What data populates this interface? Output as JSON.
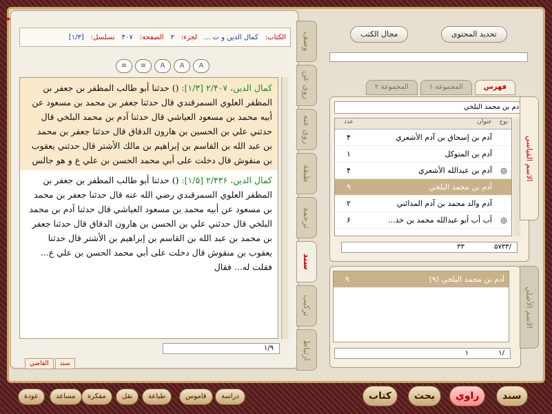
{
  "info_bar": {
    "book_label": "الكتاب:",
    "book_value": "كمال الدين و ت ...",
    "part_label": "لجزء:",
    "part_value": "۳",
    "page_label": "الصفحة:",
    "page_value": "۴۰۷",
    "seq_label": "تسلسل:",
    "seq_value": "[۱/۳]"
  },
  "toolbar_icons": [
    "format-icon-1",
    "format-icon-2",
    "format-icon-3",
    "format-icon-4",
    "format-icon-5"
  ],
  "text_para1": {
    "src": "كمال الدين، ۲/۴۰۷ [۱/۳]:",
    "body": "() حدثنا أبو طالب المظفر بن جعفر بن المظفر العلوي السمرقندي قال حدثنا جعفر بن محمد بن مسعود عن أبيه محمد بن مسعود العياشي قال حدثنا آدم بن محمد البلخي قال حدثني علي بن الحسين بن هارون الدقاق قال حدثنا جعفر بن محمد بن عبد الله بن القاسم بن إبراهيم بن مالك الأشتر قال حدثني يعقوب بن منقوش قال دخلت على أبي محمد الحسن بن علي ع و هو جالس"
  },
  "text_para2": {
    "src": "كمال الدين، ۲/۴۳۶ [۱/۵]:",
    "body": "() حدثنا أبو طالب المظفر بن جعفر بن المظفر العلوي السمرقندي رضي الله عنه قال حدثنا جعفر بن محمد بن مسعود عن أبيه محمد بن مسعود العياشي قال حدثنا آدم بن محمد البلخي قال حدثني علي بن الحسن بن هارون الدقاق قال حدثنا جعفر بن محمد بن عبد الله بن القاسم بن إبراهيم بن الأشتر قال حدثنا يعقوب بن منقوش قال دخلت على أبي محمد الحسن بن علي ع... فقلت له... فقال"
  },
  "left_page_box": "۱/۹",
  "left_tabs": [
    "القاضي",
    "سند"
  ],
  "vertical_tabs": [
    "وصف",
    "روى عن",
    "روى عنه",
    "طبقة",
    "ترجمة",
    "سند",
    "تركيب",
    "ارتباط"
  ],
  "top_buttons": {
    "refresh": "تحديد المحتوى",
    "library": "مجال الكتب"
  },
  "index_tabs": [
    "فهرس",
    "المجموعة ۱",
    "المجموعة ۲"
  ],
  "list_search_value": "آدم بن محمد البلخي",
  "grid_headers": {
    "type": "نوع",
    "title": "عنوان",
    "count": "عدد"
  },
  "grid_rows": [
    {
      "type": "",
      "title": "آدم بن إسحاق بن آدم الأشعري",
      "count": "۴"
    },
    {
      "type": "",
      "title": "آدم بن المتوكل",
      "count": "۱"
    },
    {
      "type": "◎",
      "title": "آدم بن عبدالله الأشعري",
      "count": "۴"
    },
    {
      "type": "",
      "title": "آدم بن محمد البلخي",
      "count": "۹"
    },
    {
      "type": "",
      "title": "آدم والد محمد بن آدم المدائني",
      "count": "۲"
    },
    {
      "type": "◎",
      "title": "أب أب أبو عبدالله محمد بن خذ...",
      "count": "۶"
    }
  ],
  "count_box": {
    "current": "۳۳",
    "total": "/۵۷۳۳"
  },
  "side_tab_upper": "الاسم القياسي",
  "side_tab_lower": "الاسم الأصلي",
  "lower_list_item": {
    "title": "آدم بن محمد البلخي (۹)",
    "count": "۹"
  },
  "lower_count": {
    "current": "۱",
    "total": "/۱"
  },
  "bottom_buttons": {
    "left": [
      "عودة",
      "مساعد",
      "مفكرة",
      "نقل",
      "طباعة",
      "قاموس",
      "دراسة"
    ],
    "right": [
      "سند",
      "راوي",
      "بحث",
      "كتاب"
    ]
  }
}
